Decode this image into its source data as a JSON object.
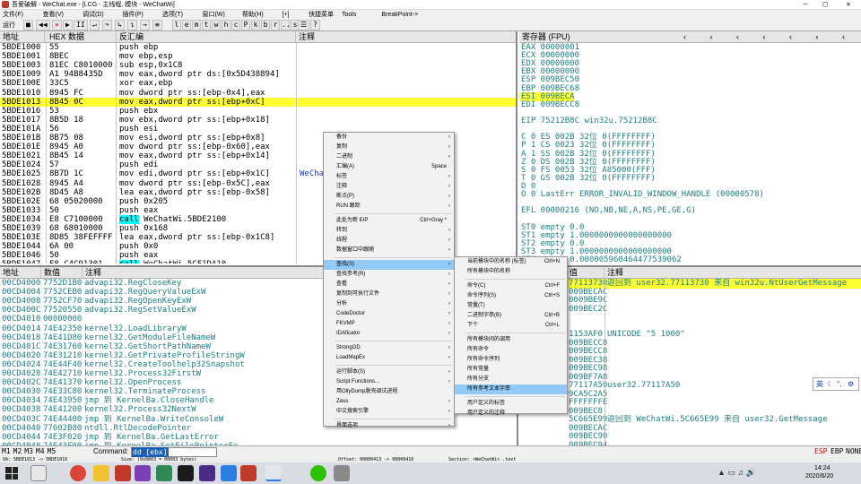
{
  "window": {
    "title": "吾爱破解 - WeChat.exe - [LCG - 主线程, 模块 - WeChatWi]"
  },
  "menu": [
    "文件(F)",
    "查看(V)",
    "调试(D)",
    "插件(P)",
    "选项(T)",
    "窗口(W)",
    "帮助(H)",
    "[+]",
    "快捷菜单",
    "Tools",
    "BreakPoint->"
  ],
  "toolbar": {
    "status": "运行",
    "letters": [
      "l",
      "e",
      "m",
      "t",
      "w",
      "h",
      "c",
      "P",
      "k",
      "b",
      "r",
      "...",
      "s"
    ]
  },
  "disasm": {
    "headers": [
      "地址",
      "HEX 数据",
      "反汇编",
      "注释"
    ],
    "rows": [
      [
        "5BDE1000",
        "55",
        "push ebp",
        ""
      ],
      [
        "5BDE1001",
        "8BEC",
        "mov ebp,esp",
        ""
      ],
      [
        "5BDE1003",
        "81EC C8010000",
        "sub esp,0x1C8",
        ""
      ],
      [
        "5BDE1009",
        "A1 94B8435D",
        "mov eax,dword ptr ds:[0x5D438894]",
        ""
      ],
      [
        "5BDE100E",
        "33C5",
        "xor eax,ebp",
        ""
      ],
      [
        "5BDE1010",
        "8945 FC",
        "mov dword ptr ss:[ebp-0x4],eax",
        ""
      ],
      [
        "5BDE1013",
        "8B45 0C",
        "mov eax,dword ptr ss:[ebp+0xC]",
        ""
      ],
      [
        "5BDE1016",
        "53",
        "push ebx",
        ""
      ],
      [
        "5BDE1017",
        "8B5D 18",
        "mov ebx,dword ptr ss:[ebp+0x18]",
        ""
      ],
      [
        "5BDE101A",
        "56",
        "push esi",
        ""
      ],
      [
        "5BDE101B",
        "8B75 08",
        "mov esi,dword ptr ss:[ebp+0x8]",
        ""
      ],
      [
        "5BDE101E",
        "8945 A0",
        "mov dword ptr ss:[ebp-0x60],eax",
        ""
      ],
      [
        "5BDE1021",
        "8B45 14",
        "mov eax,dword ptr ss:[ebp+0x14]",
        ""
      ],
      [
        "5BDE1024",
        "57",
        "push edi",
        ""
      ],
      [
        "5BDE1025",
        "8B7D 1C",
        "mov edi,dword ptr ss:[ebp+0x1C]",
        "WeCha"
      ],
      [
        "5BDE1028",
        "8945 A4",
        "mov dword ptr ss:[ebp-0x5C],eax",
        ""
      ],
      [
        "5BDE102B",
        "8D45 A8",
        "lea eax,dword ptr ss:[ebp-0x58]",
        ""
      ],
      [
        "5BDE102E",
        "68 05020000",
        "push 0x205",
        ""
      ],
      [
        "5BDE1033",
        "50",
        "push eax",
        ""
      ],
      [
        "5BDE1034",
        "E8 C7100000",
        "call WeChatWi.5BDE2100",
        ""
      ],
      [
        "5BDE1039",
        "68 68010000",
        "push 0x168",
        ""
      ],
      [
        "5BDE103E",
        "8D85 38FEFFFF",
        "lea eax,dword ptr ss:[ebp-0x1C8]",
        ""
      ],
      [
        "5BDE1044",
        "6A 00",
        "push 0x0",
        ""
      ],
      [
        "5BDE1046",
        "50",
        "push eax",
        ""
      ],
      [
        "5BDE1047",
        "E8 C4C91301",
        "call WeChatWi.5CF1DA10",
        ""
      ]
    ],
    "highlight_index": 6
  },
  "registers": {
    "header": "寄存器 (FPU)",
    "lines": [
      "EAX 00000001",
      "ECX 00000000",
      "EDX 00000000",
      "EBX 00000000",
      "ESP 009BEC50",
      "EBP 009BEC68",
      "ESI 009BECAC",
      "EDI 009BECC8",
      "",
      "EIP 75212B8C win32u.75212B8C",
      "",
      "C 0  ES 002B 32位 0(FFFFFFFF)",
      "P 1  CS 0023 32位 0(FFFFFFFF)",
      "A 1  SS 002B 32位 0(FFFFFFFF)",
      "Z 0  DS 002B 32位 0(FFFFFFFF)",
      "S 0  FS 0053 32位 A85000(FFF)",
      "T 0  GS 002B 32位 0(FFFFFFFF)",
      "D 0",
      "O 0  LastErr ERROR_INVALID_WINDOW_HANDLE (00000578)",
      "",
      "EFL 00000216 (NO,NB,NE,A,NS,PE,GE,G)",
      "",
      "ST0 empty 0.0",
      "ST1 empty 1.0000000000000000000",
      "ST2 empty 0.0",
      "ST3 empty 1.0000000000000000000",
      "ST4 empty 0.000005960464477539062"
    ]
  },
  "memory": {
    "headers": [
      "地址",
      "数值",
      "注释"
    ],
    "rows": [
      [
        "00CD4000",
        "7752D1B0",
        "advapi32.RegCloseKey"
      ],
      [
        "00CD4004",
        "7752CEB0",
        "advapi32.RegQueryValueExW"
      ],
      [
        "00CD4008",
        "7752CF70",
        "advapi32.RegOpenKeyExW"
      ],
      [
        "00CD400C",
        "77520550",
        "advapi32.RegSetValueExW"
      ],
      [
        "00CD4010",
        "00000000",
        ""
      ],
      [
        "00CD4014",
        "74E42350",
        "kernel32.LoadLibraryW"
      ],
      [
        "00CD4018",
        "74E41D80",
        "kernel32.GetModuleFileNameW"
      ],
      [
        "00CD401C",
        "74E31760",
        "kernel32.GetShortPathNameW"
      ],
      [
        "00CD4020",
        "74E31210",
        "kernel32.GetPrivateProfileStringW"
      ],
      [
        "00CD4024",
        "74E44F40",
        "kernel32.CreateToolhelp32Snapshot"
      ],
      [
        "00CD4028",
        "74E42710",
        "kernel32.Process32FirstW"
      ],
      [
        "00CD402C",
        "74E41370",
        "kernel32.OpenProcess"
      ],
      [
        "00CD4030",
        "74E33C80",
        "kernel32.TerminateProcess"
      ],
      [
        "00CD4034",
        "74E43950",
        "jmp 到 KernelBa.CloseHandle"
      ],
      [
        "00CD4038",
        "74E41200",
        "kernel32.Process32NextW"
      ],
      [
        "00CD403C",
        "74E44400",
        "jmp 到 KernelBa.WriteConsoleW"
      ],
      [
        "00CD4040",
        "77602B80",
        "ntdll.RtlDecodePointer"
      ],
      [
        "00CD4044",
        "74E3F020",
        "jmp 到 KernelBa.GetLastError"
      ],
      [
        "00CD4048",
        "74E43F00",
        "jmp 到 KernelBa.SetFilePointerEx"
      ]
    ]
  },
  "stack": {
    "headers": [
      "值",
      "注释"
    ],
    "rows": [
      [
        "77113730",
        "返回到 user32.77113730 来自 win32u.NtUserGetMessage"
      ],
      [
        "009BECAC",
        ""
      ],
      [
        "0009BE9C",
        ""
      ],
      [
        "009BEC2C",
        ""
      ],
      [
        "",
        ""
      ],
      [
        "",
        ""
      ],
      [
        "1153AF0",
        "UNICODE \"5 1000\""
      ],
      [
        "009BECC8",
        ""
      ],
      [
        "009BECC8",
        ""
      ],
      [
        "009BEC38",
        ""
      ],
      [
        "009BEC98",
        ""
      ],
      [
        "009BF7A8",
        ""
      ],
      [
        "77117A50",
        "user32.77117A50"
      ],
      [
        "9CA5C2A5",
        ""
      ],
      [
        "FFFFFFFE",
        ""
      ],
      [
        "009BEC8",
        ""
      ],
      [
        "5C665E99",
        "返回到 WeChatWi.5C665E99 来自 user32.GetMessage"
      ],
      [
        "009BECAC",
        ""
      ],
      [
        "009BEC90",
        ""
      ],
      [
        "009BEC94",
        ""
      ]
    ]
  },
  "command": {
    "tabs": [
      "M1",
      "M2",
      "M3",
      "M4",
      "M5"
    ],
    "label": "Command:",
    "value": "dd [ebx]",
    "right": [
      "ESP",
      "EBP",
      "NONE"
    ]
  },
  "statusbar": {
    "left": "VA: 5BDE1013 -> 5BDE1016",
    "size": "Size: (0x0003 = 00003 bytes)",
    "offset": "Offset: 00000413 -> 00000416",
    "section": "Section: <WeChatWi> .text"
  },
  "context_menu": {
    "items": [
      {
        "label": "备份",
        "arrow": true
      },
      {
        "label": "复制",
        "arrow": true
      },
      {
        "label": "二进制",
        "arrow": true
      },
      {
        "label": "汇编(A)",
        "key": "Space"
      },
      {
        "label": "标签",
        "arrow": true
      },
      {
        "label": "注释",
        "arrow": true
      },
      {
        "label": "断点(P)",
        "arrow": true
      },
      {
        "label": "RUN 跟踪",
        "arrow": true
      },
      {
        "sep": true
      },
      {
        "label": "此处为新 EIP",
        "key": "Ctrl+Gray *"
      },
      {
        "label": "转到",
        "arrow": true
      },
      {
        "label": "线程",
        "arrow": true
      },
      {
        "label": "数据窗口中跟随",
        "arrow": true
      },
      {
        "sep": true
      },
      {
        "label": "查找(S)",
        "arrow": true,
        "hl": true
      },
      {
        "label": "查找参考(R)",
        "arrow": true
      },
      {
        "label": "查看",
        "arrow": true
      },
      {
        "label": "复制到可执行文件",
        "arrow": true
      },
      {
        "label": "分析",
        "arrow": true
      },
      {
        "label": "CodeDoctor",
        "arrow": true
      },
      {
        "label": "FKVMP",
        "arrow": true
      },
      {
        "label": "IDAficator",
        "arrow": true
      },
      {
        "sep": true
      },
      {
        "label": "StrongOD",
        "arrow": true
      },
      {
        "label": "LoadMapEx",
        "arrow": true
      },
      {
        "sep": true
      },
      {
        "label": "运行脚本(S)",
        "arrow": true
      },
      {
        "label": "Script Functions...",
        "arrow": true
      },
      {
        "label": "用OllyDump脱壳调试进程"
      },
      {
        "label": "Zeus",
        "arrow": true
      },
      {
        "label": "中文搜索引擎",
        "arrow": true
      },
      {
        "sep": true
      },
      {
        "label": "界面选项",
        "arrow": true
      }
    ],
    "submenu": [
      {
        "label": "当前模块中的名称 (标签)",
        "key": "Ctrl+N"
      },
      {
        "label": "所有模块中的名称"
      },
      {
        "sep": true
      },
      {
        "label": "命令(C)",
        "key": "Ctrl+F"
      },
      {
        "label": "命令序列(S)",
        "key": "Ctrl+S"
      },
      {
        "label": "常量(T)"
      },
      {
        "label": "二进制字串(B)",
        "key": "Ctrl+B"
      },
      {
        "label": "下个",
        "key": "Ctrl+L"
      },
      {
        "sep": true
      },
      {
        "label": "所有模块间的调用"
      },
      {
        "label": "所有命令"
      },
      {
        "label": "所有命令序列"
      },
      {
        "label": "所有常量"
      },
      {
        "label": "所有分支"
      },
      {
        "label": "所有参考文本字串",
        "hl": true
      },
      {
        "sep": true
      },
      {
        "label": "用户定义的标签"
      },
      {
        "label": "用户定义的注释"
      }
    ]
  },
  "ime": {
    "text": "英"
  },
  "taskbar": {
    "time": "14:24",
    "date": "2020/6/20"
  },
  "colors": {
    "highlight": "#ffff33",
    "accent": "#1a36c8",
    "menu_hl": "#91c9f7",
    "eip_hl": "#00ffff"
  }
}
